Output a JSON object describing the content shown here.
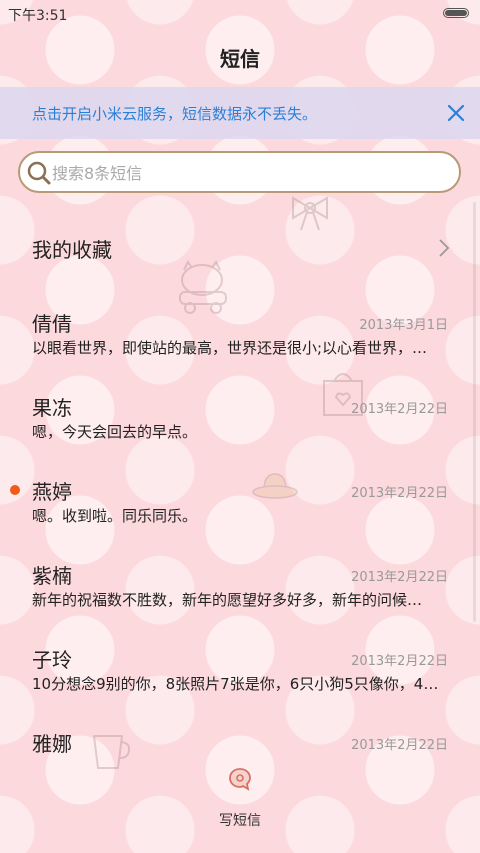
{
  "status_bar": {
    "time": "下午3:51"
  },
  "header": {
    "title": "短信"
  },
  "cloud_banner": {
    "text": "点击开启小米云服务，短信数据永不丢失。"
  },
  "search": {
    "placeholder": "搜索8条短信"
  },
  "favorites": {
    "label": "我的收藏"
  },
  "messages": [
    {
      "name": "倩倩",
      "date": "2013年3月1日",
      "preview": "以眼看世界，即使站的最高，世界还是很小;以心看世界，…",
      "unread": false
    },
    {
      "name": "果冻",
      "date": "2013年2月22日",
      "preview": "嗯，今天会回去的早点。",
      "unread": false
    },
    {
      "name": "燕婷",
      "date": "2013年2月22日",
      "preview": "嗯。收到啦。同乐同乐。",
      "unread": true
    },
    {
      "name": "紫楠",
      "date": "2013年2月22日",
      "preview": "新年的祝福数不胜数，新年的愿望好多好多，新年的问候…",
      "unread": false
    },
    {
      "name": "子玲",
      "date": "2013年2月22日",
      "preview": "10分想念9别的你，8张照片7张是你，6只小狗5只像你，4…",
      "unread": false
    },
    {
      "name": "雅娜",
      "date": "2013年2月22日",
      "preview": "",
      "unread": false
    }
  ],
  "compose": {
    "label": "写短信"
  },
  "colors": {
    "accent_blue": "#2a7fd6",
    "unread": "#f05a1a",
    "background": "#fcd9dd"
  },
  "icons": [
    "battery-icon",
    "close-icon",
    "search-icon",
    "chevron-right-icon",
    "compose-icon"
  ]
}
